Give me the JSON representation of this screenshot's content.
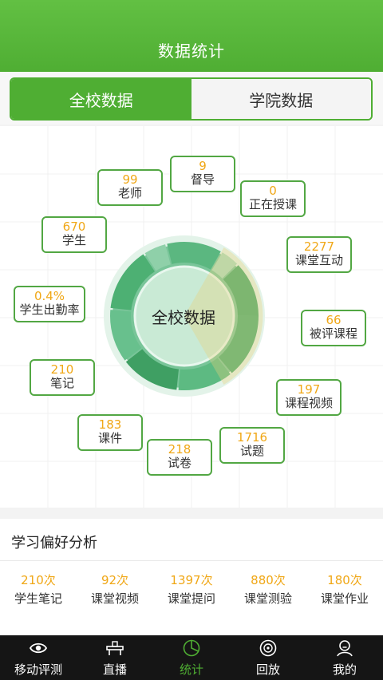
{
  "header": {
    "title": "数据统计"
  },
  "segments": [
    {
      "label": "全校数据",
      "active": true
    },
    {
      "label": "学院数据",
      "active": false
    }
  ],
  "chart": {
    "center_label": "全校数据"
  },
  "stats": [
    {
      "value": "99",
      "label": "老师"
    },
    {
      "value": "9",
      "label": "督导"
    },
    {
      "value": "0",
      "label": "正在授课"
    },
    {
      "value": "670",
      "label": "学生"
    },
    {
      "value": "2277",
      "label": "课堂互动"
    },
    {
      "value": "0.4%",
      "label": "学生出勤率"
    },
    {
      "value": "66",
      "label": "被评课程"
    },
    {
      "value": "210",
      "label": "笔记"
    },
    {
      "value": "197",
      "label": "课程视频"
    },
    {
      "value": "183",
      "label": "课件"
    },
    {
      "value": "218",
      "label": "试卷"
    },
    {
      "value": "1716",
      "label": "试题"
    }
  ],
  "preference": {
    "title": "学习偏好分析",
    "items": [
      {
        "value": "210次",
        "label": "学生笔记"
      },
      {
        "value": "92次",
        "label": "课堂视频"
      },
      {
        "value": "1397次",
        "label": "课堂提问"
      },
      {
        "value": "880次",
        "label": "课堂测验"
      },
      {
        "value": "180次",
        "label": "课堂作业"
      }
    ]
  },
  "tabbar": [
    {
      "label": "移动评测",
      "icon": "eye-icon",
      "active": false
    },
    {
      "label": "直播",
      "icon": "live-desk-icon",
      "active": false
    },
    {
      "label": "统计",
      "icon": "pie-chart-icon",
      "active": true
    },
    {
      "label": "回放",
      "icon": "replay-icon",
      "active": false
    },
    {
      "label": "我的",
      "icon": "user-icon",
      "active": false
    }
  ],
  "colors": {
    "brand_green": "#4fae33",
    "value_orange": "#f0a716",
    "highlight_yellow": "#f9e4ad"
  }
}
